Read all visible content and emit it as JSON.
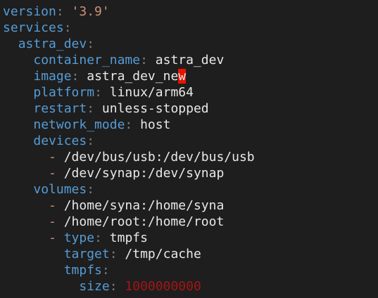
{
  "editor": {
    "version_key": "version",
    "version_value": "'3.9'",
    "services_key": "services",
    "service_name": "astra_dev",
    "container_name_key": "container_name",
    "container_name_value": "astra_dev",
    "image_key": "image",
    "image_value_pre": "astra_dev_ne",
    "image_value_cursor": "w",
    "platform_key": "platform",
    "platform_value": "linux/arm64",
    "restart_key": "restart",
    "restart_value": "unless-stopped",
    "network_mode_key": "network_mode",
    "network_mode_value": "host",
    "devices_key": "devices",
    "devices": [
      "/dev/bus/usb:/dev/bus/usb",
      "/dev/synap:/dev/synap"
    ],
    "volumes_key": "volumes",
    "volumes": [
      "/home/syna:/home/syna",
      "/home/root:/home/root"
    ],
    "type_key": "type",
    "type_value": "tmpfs",
    "target_key": "target",
    "target_value": "/tmp/cache",
    "tmpfs_key": "tmpfs",
    "size_key": "size",
    "size_value": "1000000000",
    "colon": ":",
    "dash": "-"
  },
  "colors": {
    "background": "#1e1e1e",
    "key": "#569cd6",
    "string": "#ce9178",
    "number": "#a31515",
    "cursor": "#e51400"
  }
}
